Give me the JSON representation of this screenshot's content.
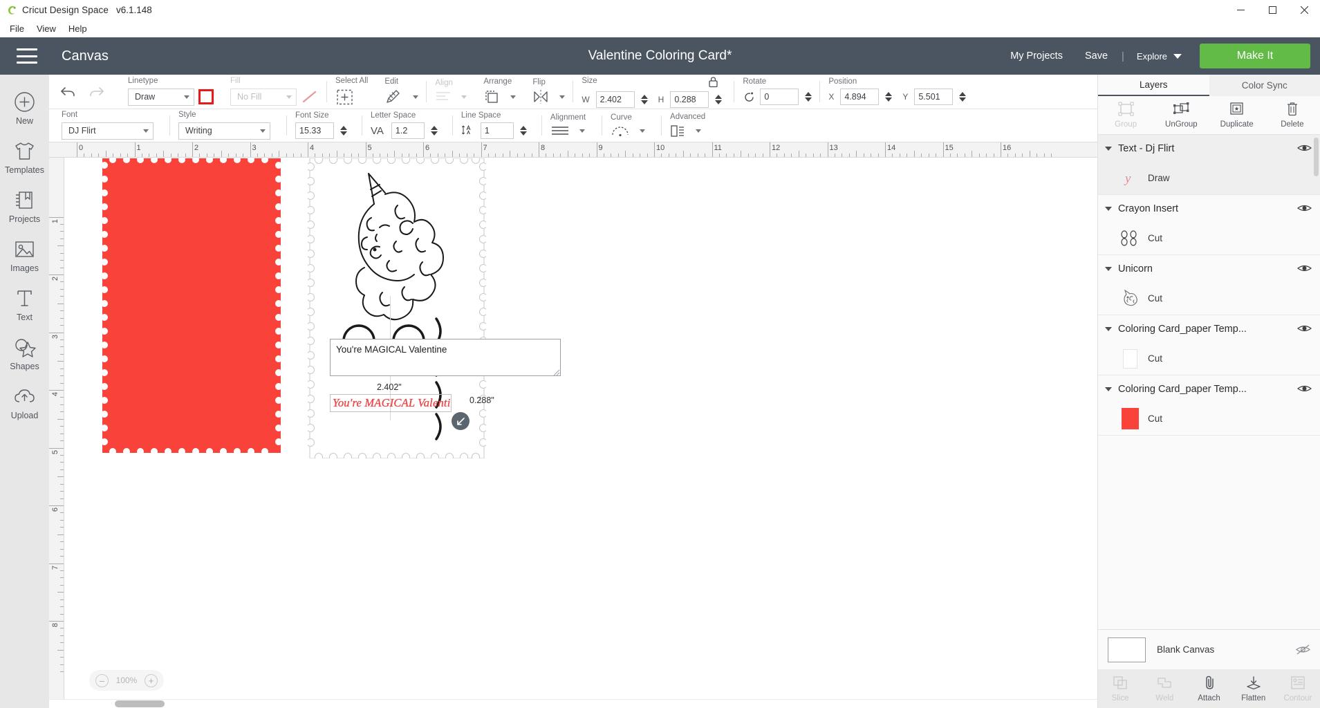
{
  "titlebar": {
    "app_name": "Cricut Design Space",
    "version": "v6.1.148",
    "minimize": "–",
    "maximize": "❐",
    "close": "✕"
  },
  "menubar": {
    "items": [
      {
        "label": "File"
      },
      {
        "label": "View"
      },
      {
        "label": "Help"
      }
    ]
  },
  "header": {
    "canvas_label": "Canvas",
    "project_title": "Valentine Coloring Card*",
    "my_projects": "My Projects",
    "save": "Save",
    "divider": "|",
    "explore": "Explore",
    "make_it": "Make It",
    "bg_color": "#4b5561",
    "make_it_color": "#62bb46"
  },
  "sidebar": {
    "items": [
      {
        "label": "New",
        "icon": "plus-circle-icon"
      },
      {
        "label": "Templates",
        "icon": "tshirt-icon"
      },
      {
        "label": "Projects",
        "icon": "book-icon"
      },
      {
        "label": "Images",
        "icon": "picture-icon"
      },
      {
        "label": "Text",
        "icon": "text-t-icon"
      },
      {
        "label": "Shapes",
        "icon": "shapes-icon"
      },
      {
        "label": "Upload",
        "icon": "cloud-upload-icon"
      }
    ]
  },
  "toolbar_primary": {
    "undo": "undo-icon",
    "redo": "redo-icon",
    "linetype": {
      "label": "Linetype",
      "value": "Draw"
    },
    "fill": {
      "label": "Fill",
      "value": "No Fill"
    },
    "select_all": {
      "label": "Select All"
    },
    "edit": {
      "label": "Edit"
    },
    "align": {
      "label": "Align"
    },
    "arrange": {
      "label": "Arrange"
    },
    "flip": {
      "label": "Flip"
    },
    "size": {
      "label": "Size",
      "w_label": "W",
      "w_value": "2.402",
      "h_label": "H",
      "h_value": "0.288"
    },
    "rotate": {
      "label": "Rotate",
      "value": "0"
    },
    "position": {
      "label": "Position",
      "x_label": "X",
      "x_value": "4.894",
      "y_label": "Y",
      "y_value": "5.501"
    },
    "swatch_color": "#e8191b"
  },
  "toolbar_text": {
    "font": {
      "label": "Font",
      "value": "DJ Flirt"
    },
    "style": {
      "label": "Style",
      "value": "Writing"
    },
    "font_size": {
      "label": "Font Size",
      "value": "15.33"
    },
    "letter_space": {
      "label": "Letter Space",
      "value": "1.2",
      "icon": "VA"
    },
    "line_space": {
      "label": "Line Space",
      "value": "1"
    },
    "alignment": {
      "label": "Alignment"
    },
    "curve": {
      "label": "Curve"
    },
    "advanced": {
      "label": "Advanced"
    }
  },
  "ruler": {
    "h_labels": [
      "0",
      "1",
      "2",
      "3",
      "4",
      "5",
      "6",
      "7",
      "8",
      "9",
      "10",
      "11",
      "12",
      "13",
      "14",
      "15",
      "16"
    ],
    "v_labels": [
      "1",
      "2",
      "3",
      "4",
      "5",
      "6",
      "7",
      "8"
    ]
  },
  "canvas": {
    "text_edit_value": "You're MAGICAL Valentine",
    "selected_text": "You're MAGICAL Valentine",
    "dimension_width": "2.402\"",
    "dimension_height": "0.288\"",
    "zoom_level": "100%",
    "zoom_out": "–",
    "zoom_in": "+",
    "red_card_color": "#f9423a",
    "text_ink_color": "#e8494a"
  },
  "right_panel": {
    "tabs": [
      {
        "label": "Layers",
        "active": true
      },
      {
        "label": "Color Sync",
        "active": false
      }
    ],
    "actions": [
      {
        "label": "Group",
        "icon": "group-icon",
        "disabled": true
      },
      {
        "label": "UnGroup",
        "icon": "ungroup-icon",
        "disabled": false
      },
      {
        "label": "Duplicate",
        "icon": "duplicate-icon",
        "disabled": false
      },
      {
        "label": "Delete",
        "icon": "trash-icon",
        "disabled": false
      }
    ],
    "layers": [
      {
        "name": "Text - Dj Flirt",
        "child_label": "Draw",
        "thumb": "script-letter",
        "selected": true
      },
      {
        "name": "Crayon Insert",
        "child_label": "Cut",
        "thumb": "crayon-slots",
        "selected": false
      },
      {
        "name": "Unicorn",
        "child_label": "Cut",
        "thumb": "unicorn",
        "selected": false
      },
      {
        "name": "Coloring Card_paper Temp...",
        "child_label": "Cut",
        "thumb": "white-swatch",
        "selected": false
      },
      {
        "name": "Coloring Card_paper Temp...",
        "child_label": "Cut",
        "thumb": "red-swatch",
        "selected": false
      }
    ],
    "blank_canvas": {
      "label": "Blank Canvas",
      "icon": "eye-off-icon"
    },
    "bottom_tools": [
      {
        "label": "Slice",
        "icon": "slice-icon",
        "disabled": true
      },
      {
        "label": "Weld",
        "icon": "weld-icon",
        "disabled": true
      },
      {
        "label": "Attach",
        "icon": "paperclip-icon",
        "disabled": false
      },
      {
        "label": "Flatten",
        "icon": "flatten-icon",
        "disabled": false
      },
      {
        "label": "Contour",
        "icon": "contour-icon",
        "disabled": true
      }
    ]
  }
}
